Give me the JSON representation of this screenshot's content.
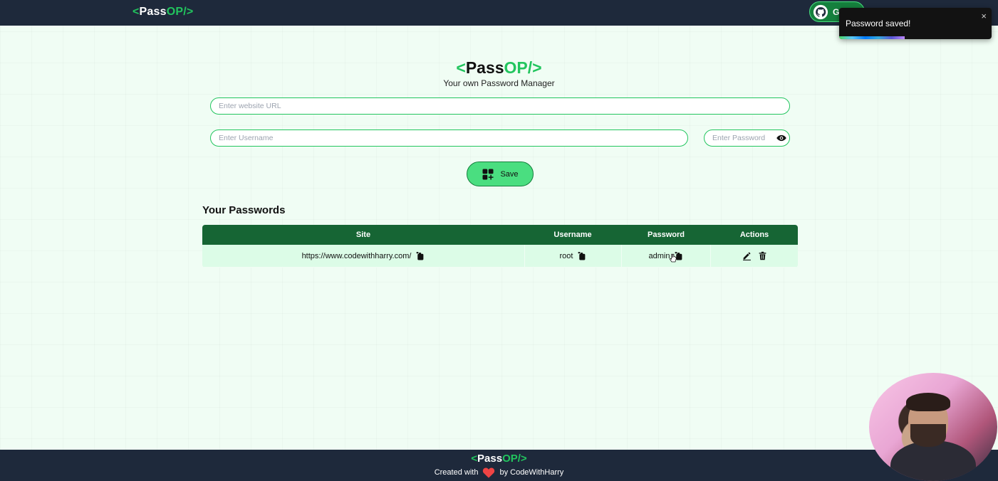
{
  "nav": {
    "logo_open": "<",
    "logo_pass": "Pass",
    "logo_op": "OP/>",
    "github_label": "GitHub",
    "github_visible": "G"
  },
  "toast": {
    "message": "Password saved!",
    "close": "×",
    "progress": 0.43
  },
  "header": {
    "logo_open": "<",
    "logo_pass": "Pass",
    "logo_op": "OP/>",
    "tagline": "Your own Password Manager"
  },
  "form": {
    "url_placeholder": "Enter website URL",
    "username_placeholder": "Enter Username",
    "password_placeholder": "Enter Password",
    "save_label": "Save"
  },
  "passwords": {
    "title": "Your Passwords",
    "columns": [
      "Site",
      "Username",
      "Password",
      "Actions"
    ],
    "rows": [
      {
        "site": "https://www.codewithharry.com/",
        "username": "root",
        "password": "admin"
      }
    ]
  },
  "footer": {
    "logo_open": "<",
    "logo_pass": "Pass",
    "logo_op": "OP/>",
    "created_with": "Created with",
    "by": "by CodeWithHarry"
  },
  "colors": {
    "nav_bg": "#1e293b",
    "accent_green": "#22c55e",
    "table_header": "#166534",
    "row_bg": "#dcfce7",
    "save_bg": "#4ade80"
  }
}
